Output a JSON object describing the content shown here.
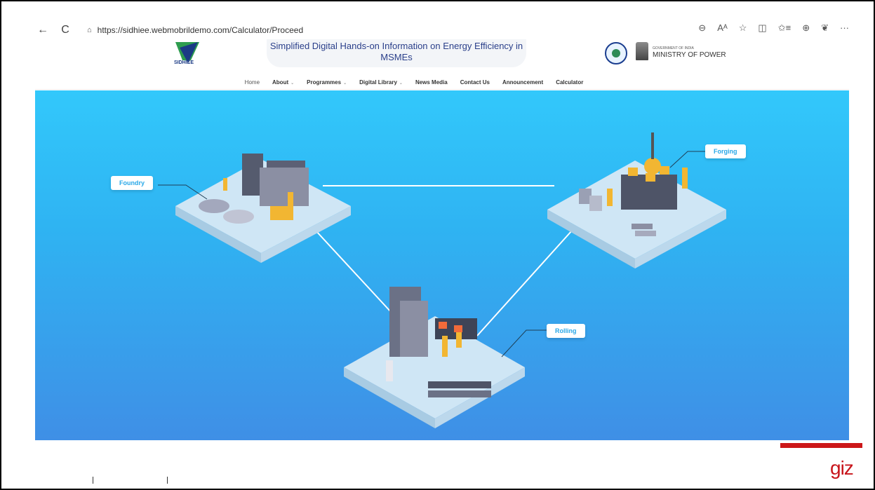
{
  "browser": {
    "url": "https://sidhiee.webmobrildemo.com/Calculator/Proceed",
    "back_icon": "←",
    "reload_icon": "C",
    "tools": [
      "⊖",
      "Aᴬ",
      "☆",
      "◫",
      "✩≡",
      "⊕",
      "❦",
      "···"
    ]
  },
  "header": {
    "logo_text": "SIDHIEE",
    "title": "Simplified Digital Hands-on Information on Energy Efficiency in MSMEs",
    "gov_small": "GOVERNMENT OF INDIA",
    "ministry": "MINISTRY OF POWER"
  },
  "nav": {
    "items": [
      {
        "label": "Home",
        "dropdown": false
      },
      {
        "label": "About",
        "dropdown": true
      },
      {
        "label": "Programmes",
        "dropdown": true
      },
      {
        "label": "Digital Library",
        "dropdown": true
      },
      {
        "label": "News Media",
        "dropdown": false
      },
      {
        "label": "Contact Us",
        "dropdown": false
      },
      {
        "label": "Announcement",
        "dropdown": false
      },
      {
        "label": "Calculator",
        "dropdown": false
      }
    ]
  },
  "processes": {
    "foundry": "Foundry",
    "forging": "Forging",
    "rolling": "Rolling"
  },
  "widgets": {
    "chat_icon": "■",
    "top_icon": "⌃"
  },
  "footer": {
    "brand": "giz",
    "accent": "#cc1719"
  },
  "colors": {
    "hero_top": "#32c8fb",
    "hero_bottom": "#3f8fe6",
    "label_text": "#29a8e8"
  }
}
